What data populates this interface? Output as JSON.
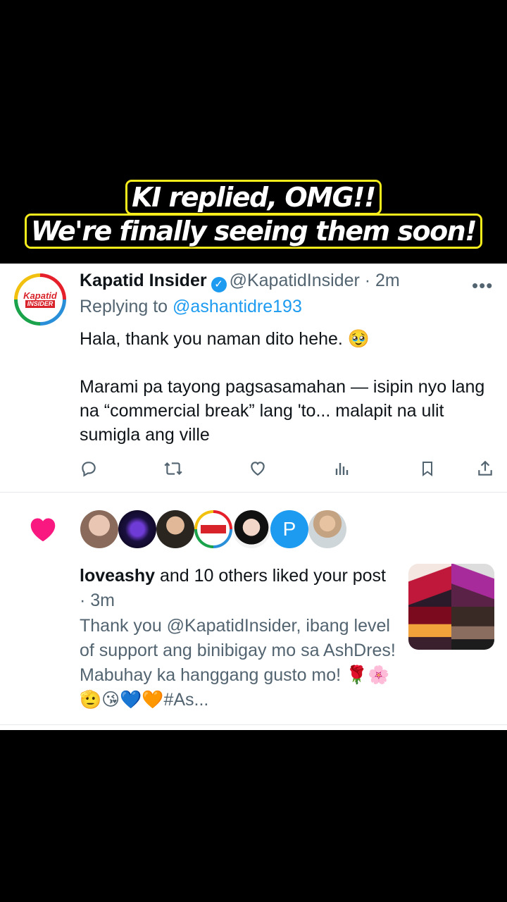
{
  "caption": {
    "line1": "KI replied, OMG!!",
    "line2": "We're finally seeing them soon!",
    "border_color": "#f7ec1c"
  },
  "tweet": {
    "avatar_text_top": "Kapatid",
    "avatar_text_bottom": "INSIDER",
    "author_name": "Kapatid Insider",
    "verified_icon": "verified-badge-icon",
    "handle_time": "@KapatidInsider · 2m",
    "replying_prefix": "Replying to",
    "replying_to": "@ashantidre193",
    "body_line1": "Hala, thank you naman dito hehe. 🥹",
    "body_line2": "Marami pa tayong pagsasamahan — isipin nyo lang na “commercial break” lang 'to... malapit na ulit sumigla ang ville",
    "more": "•••",
    "actions": [
      "reply-icon",
      "retweet-icon",
      "like-icon",
      "views-icon",
      "bookmark-icon",
      "share-icon"
    ]
  },
  "notification": {
    "heart_color": "#f91880",
    "avatar_letter": "P",
    "liker": "loveashy",
    "rest": " and 10 others liked your post",
    "time": " · 3m",
    "quote": "Thank you @KapatidInsider, ibang level of support ang binibigay mo sa AshDres! Mabuhay ka hanggang gusto mo! 🌹🌸🫡😘💙🧡#As..."
  },
  "colors": {
    "link": "#1d9bf0",
    "secondary_text": "#536471",
    "primary_text": "#0f1419"
  }
}
